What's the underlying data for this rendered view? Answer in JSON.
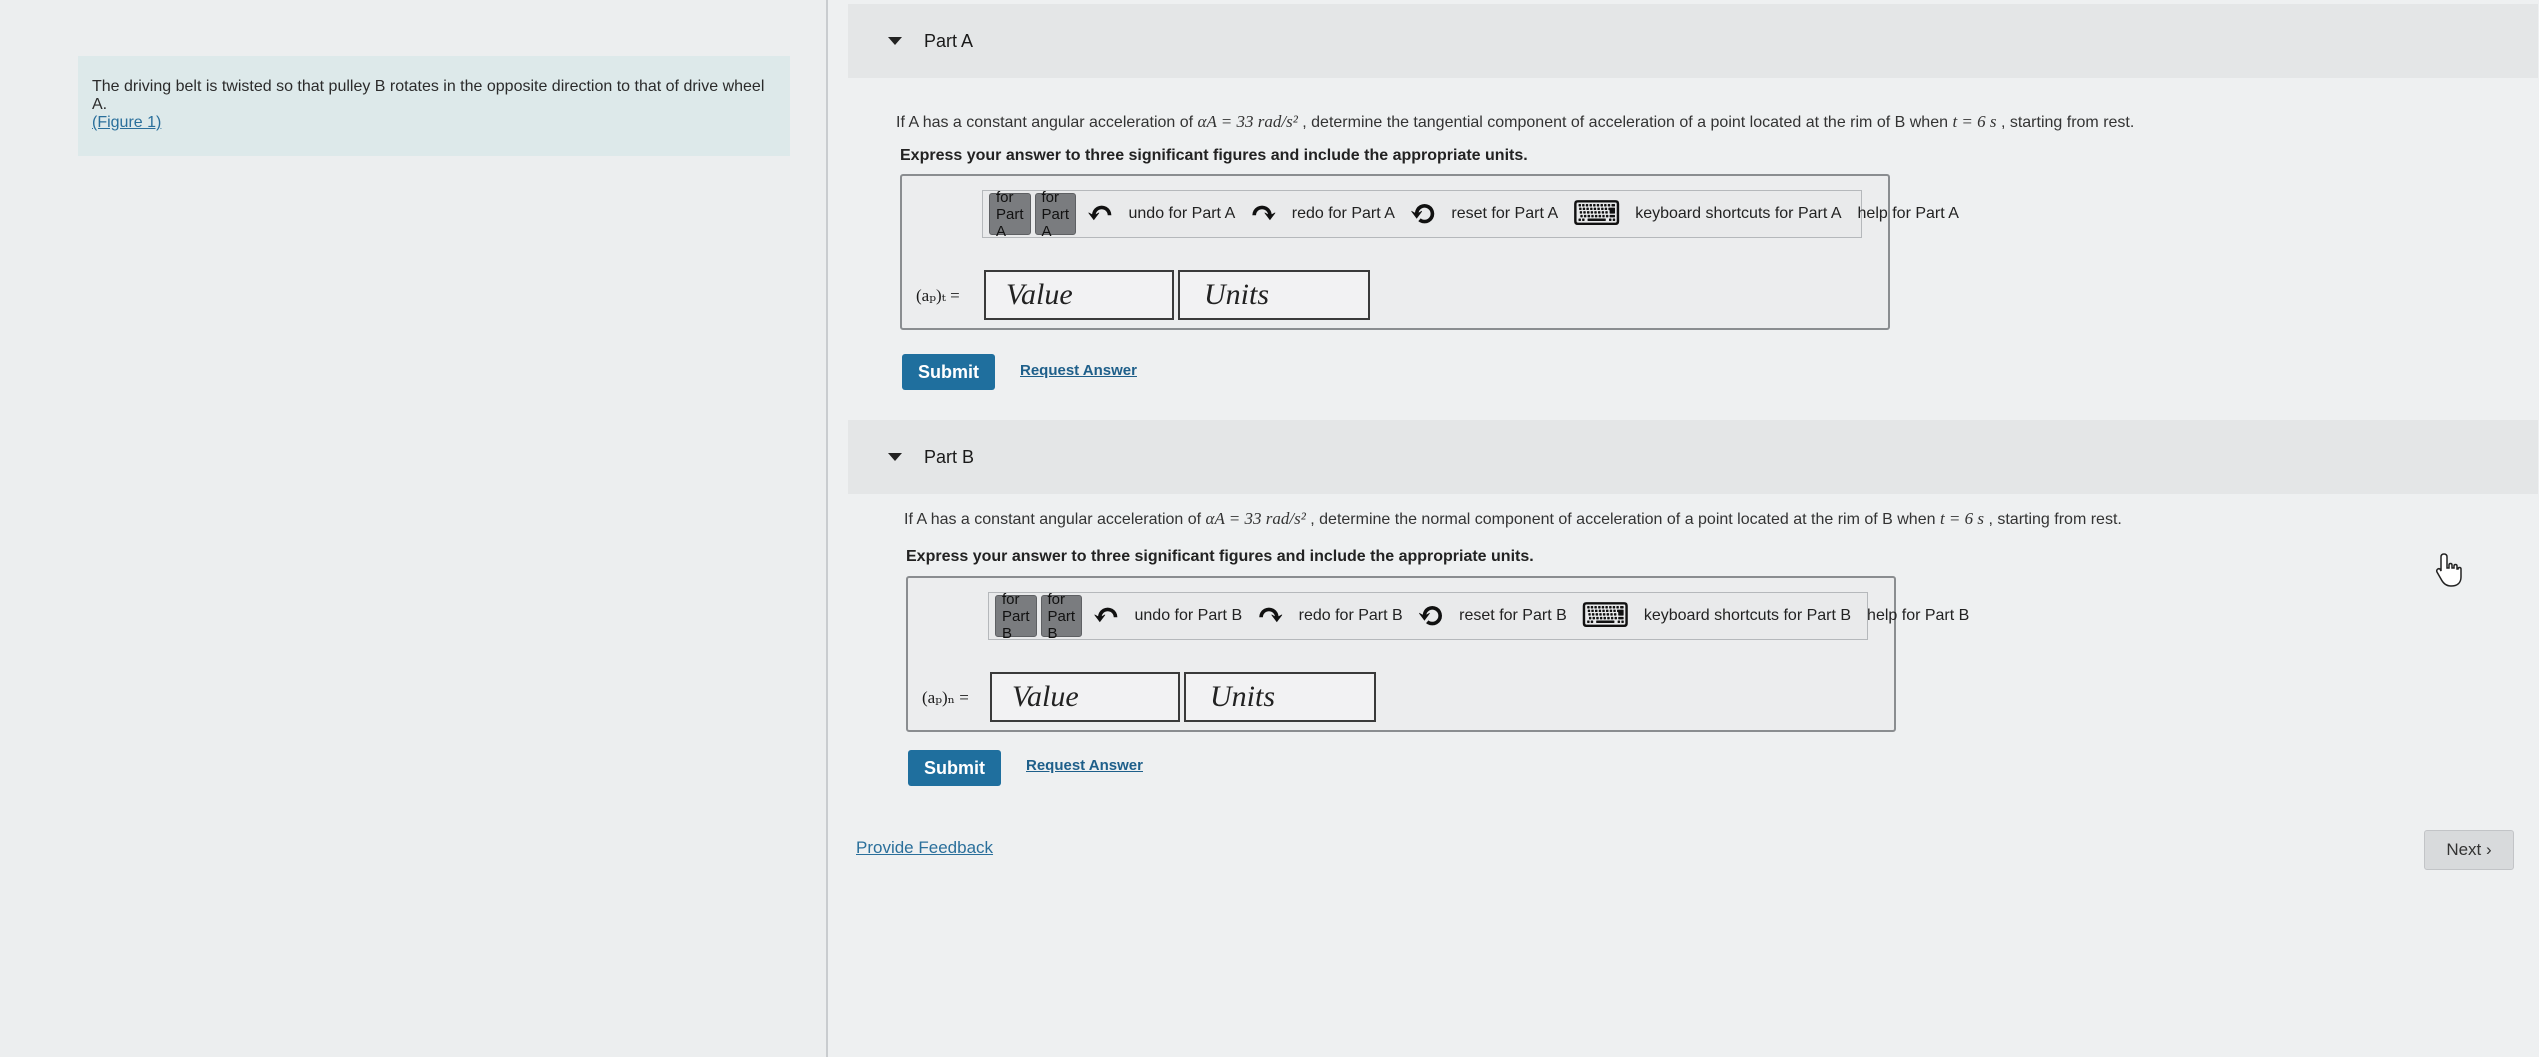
{
  "problem": {
    "text": "The driving belt is twisted so that pulley B rotates in the opposite direction to that of drive wheel A.",
    "figure_link": "(Figure 1)"
  },
  "partA": {
    "title": "Part A",
    "question_pre": "If A has a constant angular acceleration of ",
    "alpha": "αA = 33 rad/s²",
    "question_mid": " , determine the tangential component of acceleration of a point located at the rim of B when ",
    "time": "t = 6 s",
    "question_post": " , starting from rest.",
    "instruction": "Express your answer to three significant figures and include the appropriate units.",
    "toolbar": {
      "btn1": "for Part A",
      "btn2": "for Part A",
      "undo": "undo for Part A",
      "redo": "redo for Part A",
      "reset": "reset for Part A",
      "shortcuts": "keyboard shortcuts for Part A",
      "help": "help for Part A"
    },
    "var_label": "(aₚ)ₜ =",
    "value_placeholder": "Value",
    "units_placeholder": "Units",
    "submit": "Submit",
    "request": "Request Answer"
  },
  "partB": {
    "title": "Part B",
    "question_pre": "If A has a constant angular acceleration of ",
    "alpha": "αA = 33 rad/s²",
    "question_mid": " , determine the normal component of acceleration of a point located at the rim of B when ",
    "time": "t = 6 s",
    "question_post": " , starting from rest.",
    "instruction": "Express your answer to three significant figures and include the appropriate units.",
    "toolbar": {
      "btn1": "for Part B",
      "btn2": "for Part B",
      "undo": "undo for Part B",
      "redo": "redo for Part B",
      "reset": "reset for Part B",
      "shortcuts": "keyboard shortcuts for Part B",
      "help": "help for Part B"
    },
    "var_label": "(aₚ)ₙ =",
    "value_placeholder": "Value",
    "units_placeholder": "Units",
    "submit": "Submit",
    "request": "Request Answer"
  },
  "footer": {
    "feedback": "Provide Feedback",
    "next": "Next ›"
  },
  "icons": {
    "caret": "caret-down-icon",
    "cursor": "hand-pointer-icon"
  },
  "colors": {
    "accent": "#1f6f9e",
    "problem_bg": "#dde9ea"
  }
}
